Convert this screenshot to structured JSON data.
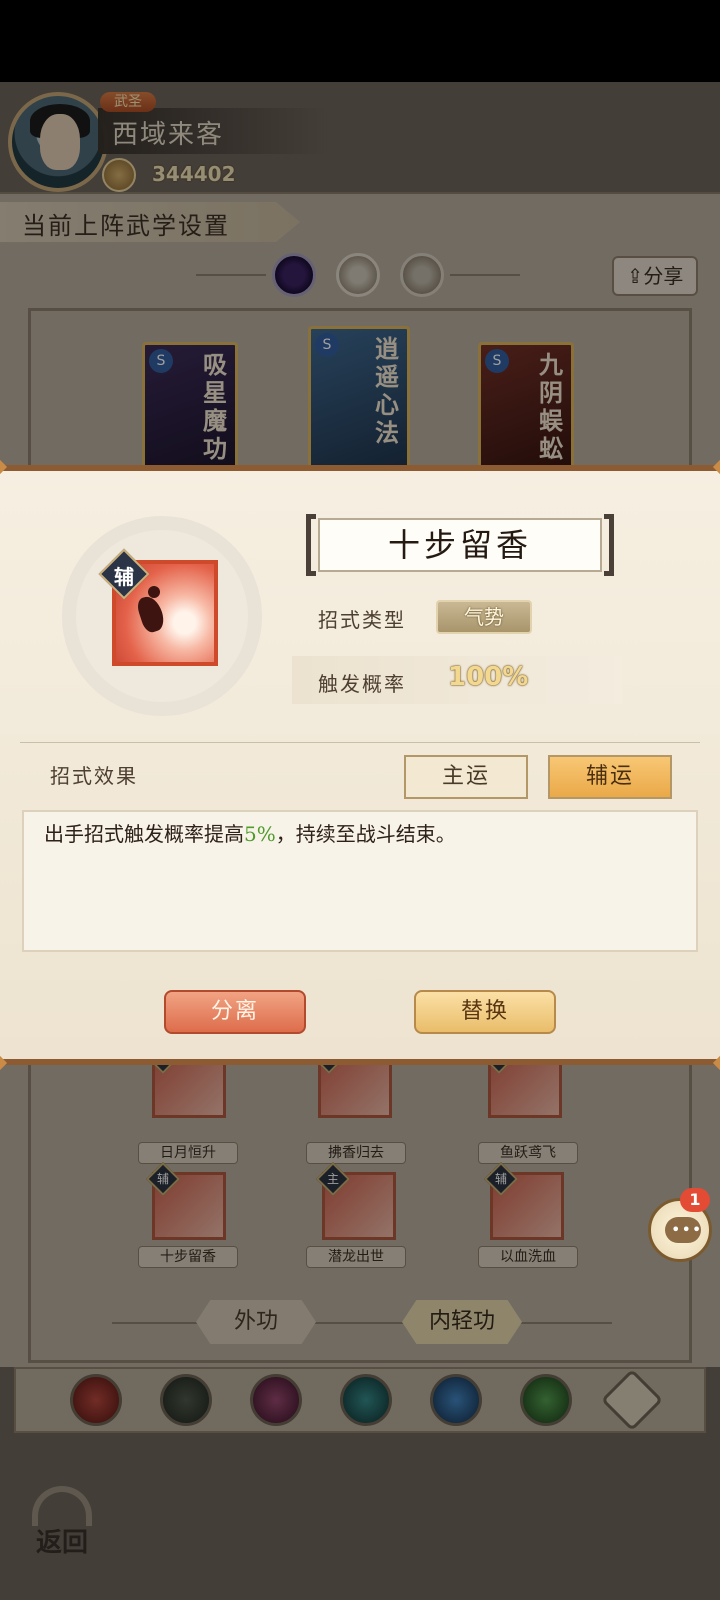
{
  "player": {
    "title": "武圣",
    "name": "西域来客",
    "power": "344402"
  },
  "page": {
    "section_title": "当前上阵武学设置",
    "share_label": "分享"
  },
  "cards": [
    {
      "name": "吸星魔功",
      "grade": "S"
    },
    {
      "name": "逍遥心法",
      "grade": "S"
    },
    {
      "name": "九阴蜈蚣",
      "grade": "S"
    }
  ],
  "skills": [
    {
      "name": "日月恒升",
      "tag": "辅"
    },
    {
      "name": "拂香归去",
      "tag": "主"
    },
    {
      "name": "鱼跃鸢飞",
      "tag": "辅"
    },
    {
      "name": "十步留香",
      "tag": "辅"
    },
    {
      "name": "潜龙出世",
      "tag": "主"
    },
    {
      "name": "以血洗血",
      "tag": "辅"
    }
  ],
  "kungfu_tabs": [
    "外功",
    "内轻功"
  ],
  "back_label": "返回",
  "chat": {
    "unread": "1"
  },
  "modal": {
    "aux_tag": "辅",
    "skill_name": "十步留香",
    "type_label": "招式类型",
    "type_value": "气势",
    "prob_label": "触发概率",
    "prob_value": "100%",
    "effect_label": "招式效果",
    "mode_main": "主运",
    "mode_aux": "辅运",
    "mode_selected": "辅运",
    "effect_text_prefix": "出手招式触发概率提高",
    "effect_highlight": "5%",
    "effect_text_suffix": "，持续至战斗结束。",
    "separate_label": "分离",
    "replace_label": "替换"
  },
  "colors": {
    "accent_orange": "#eaa949",
    "highlight_green": "#4f9b2b",
    "separate_red": "#dd6d4c",
    "badge_red": "#e34b35"
  }
}
